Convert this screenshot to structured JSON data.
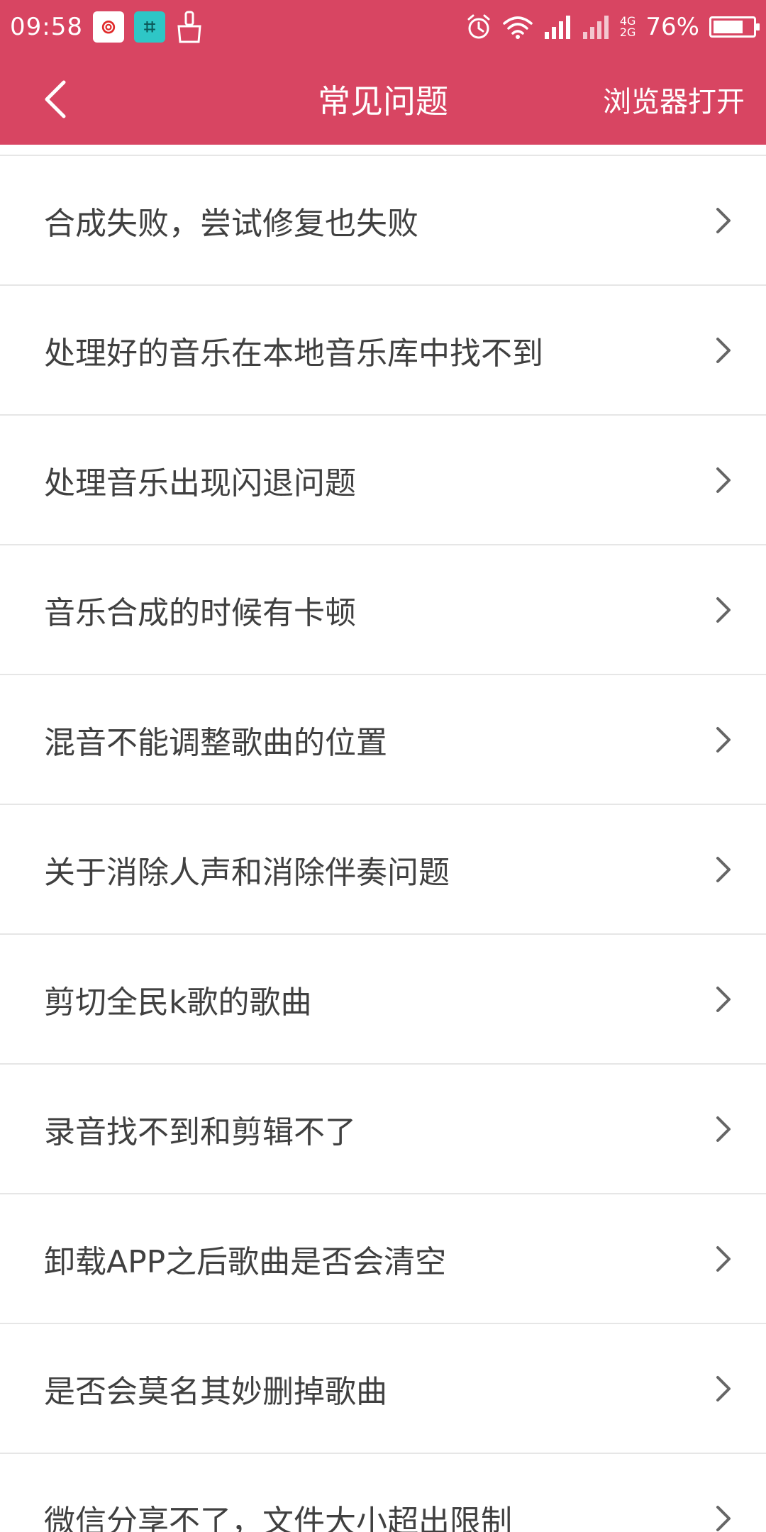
{
  "status_bar": {
    "time": "09:58",
    "network_top": "4G",
    "network_bottom": "2G",
    "battery_percent": "76%",
    "battery_level": 0.76
  },
  "app_bar": {
    "title": "常见问题",
    "action_label": "浏览器打开"
  },
  "faq_items": [
    {
      "label": "合成失败，尝试修复也失败"
    },
    {
      "label": "处理好的音乐在本地音乐库中找不到"
    },
    {
      "label": "处理音乐出现闪退问题"
    },
    {
      "label": "音乐合成的时候有卡顿"
    },
    {
      "label": "混音不能调整歌曲的位置"
    },
    {
      "label": "关于消除人声和消除伴奏问题"
    },
    {
      "label": "剪切全民k歌的歌曲"
    },
    {
      "label": "录音找不到和剪辑不了"
    },
    {
      "label": "卸载APP之后歌曲是否会清空"
    },
    {
      "label": "是否会莫名其妙删掉歌曲"
    },
    {
      "label": "微信分享不了，文件大小超出限制"
    }
  ],
  "colors": {
    "accent": "#d84562",
    "text": "#404040",
    "divider": "#e6e6e6",
    "chevron": "#666666"
  }
}
